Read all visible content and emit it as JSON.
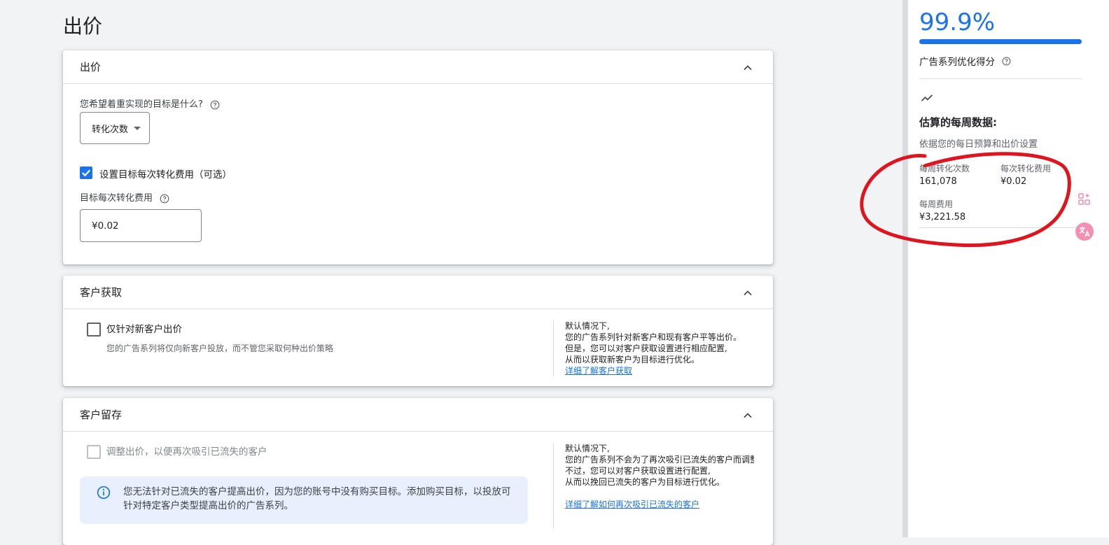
{
  "page": {
    "title": "出价"
  },
  "bidding": {
    "title": "出价",
    "goal_question": "您希望着重实现的目标是什么?",
    "goal_value": "转化次数",
    "set_target_label": "设置目标每次转化费用（可选）",
    "target_label": "目标每次转化费用",
    "target_value": "¥0.02"
  },
  "acquisition": {
    "title": "客户获取",
    "checkbox_label": "仅针对新客户出价",
    "checkbox_sub": "您的广告系列将仅向新客户投放，而不管您采取何种出价策略",
    "note_lines": [
      "默认情况下,",
      "您的广告系列针对新客户和现有客户平等出价。",
      "但是，您可以对客户获取设置进行相应配置,",
      "从而以获取新客户为目标进行优化。"
    ],
    "note_link": "详细了解客户获取"
  },
  "retention": {
    "title": "客户留存",
    "checkbox_label": "调整出价，以便再次吸引已流失的客户",
    "info_text": "您无法针对已流失的客户提高出价，因为您的账号中没有购买目标。添加购买目标，以投放可针对特定客户类型提高出价的广告系列。",
    "note_lines": [
      "默认情况下,",
      "您的广告系列不会为了再次吸引已流失的客户而调整",
      "不过，您可以对客户获取设置进行配置,",
      "从而以挽回已流失的客户为目标进行优化。"
    ],
    "note_link": "详细了解如何再次吸引已流失的客户"
  },
  "panel": {
    "score": "99.9%",
    "score_fraction": 0.999,
    "score_label": "广告系列优化得分",
    "estimate_title": "估算的每周数据:",
    "estimate_sub": "依据您的每日预算和出价设置",
    "metrics": {
      "weekly_conversions_label": "每周转化次数",
      "weekly_conversions_value": "161,078",
      "cost_per_conv_label": "每次转化费用",
      "cost_per_conv_value": "¥0.02",
      "weekly_cost_label": "每周费用",
      "weekly_cost_value": "¥3,221.58"
    }
  },
  "colors": {
    "accent": "#1a73e8",
    "annotation": "#e0141e"
  }
}
